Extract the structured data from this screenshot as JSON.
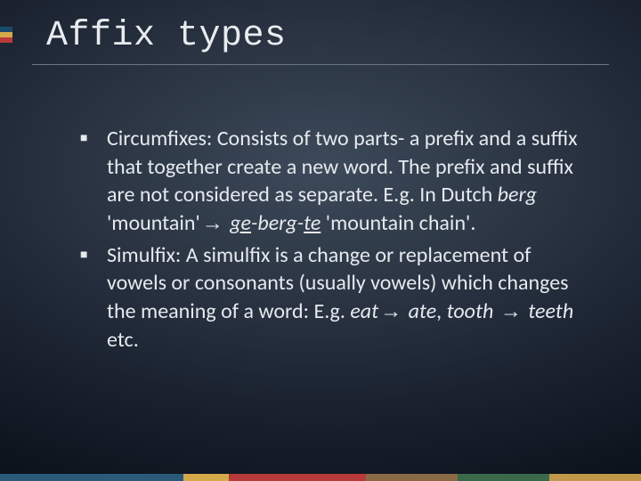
{
  "title": "Affix types",
  "bullets": [
    {
      "term": "Circumfixes",
      "definition_pre": ": Consists of two parts- a prefix and a suffix that together create a new word. The prefix and suffix are not considered as separate. E.g. In Dutch ",
      "example_source": "berg",
      "example_gloss_source": " 'mountain'",
      "arrow": "→",
      "example_target_pre_u": "ge",
      "example_target_mid": "-berg-",
      "example_target_post_u": "te",
      "example_gloss_target": " 'mountain chain'."
    },
    {
      "term": "Simulfix",
      "definition_pre": ": A simulfix is a change or replacement of vowels or consonants (usually vowels) which changes the meaning of a word: E.g. ",
      "ex1_src": "eat",
      "arrow1": "→",
      "ex1_tgt": " ate",
      "sep": ", ",
      "ex2_src": "tooth ",
      "arrow2": "→",
      "ex2_tgt": " teeth",
      "tail": " etc."
    }
  ]
}
